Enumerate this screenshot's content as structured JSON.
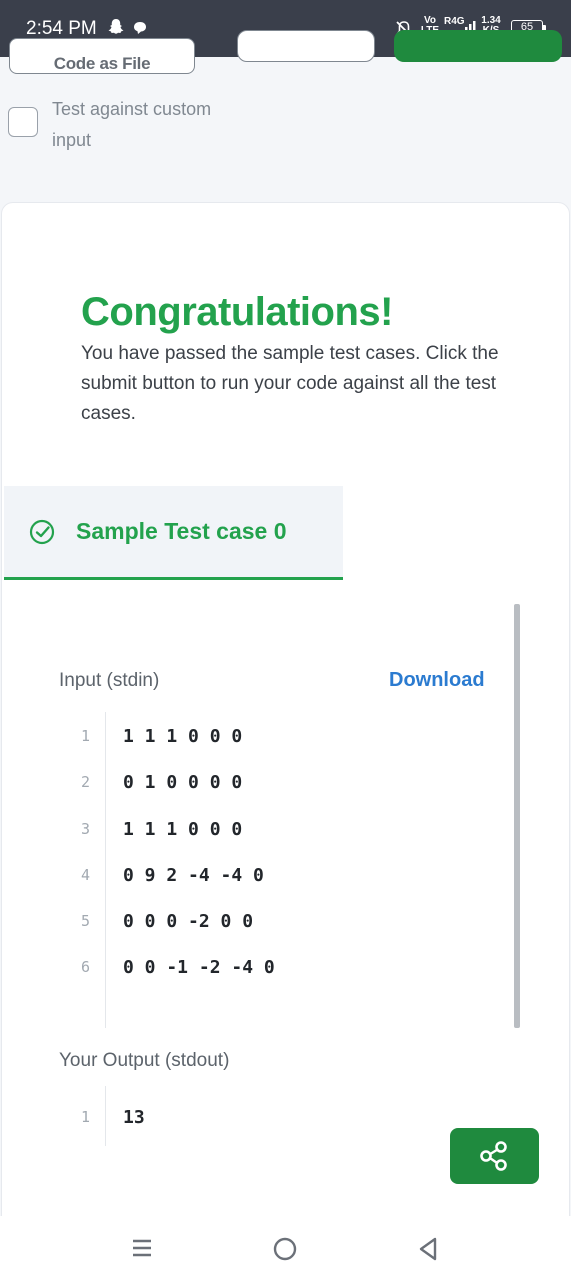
{
  "status_bar": {
    "time": "2:54 PM",
    "volte_top": "Vo",
    "volte_bottom": "LTE",
    "network": "R4G",
    "speed_value": "1.34",
    "speed_unit": "K/S",
    "battery": "65"
  },
  "toolbar": {
    "upload_code_label": "Code as File"
  },
  "custom_input": {
    "label": "Test against custom input",
    "checked": false
  },
  "result": {
    "title": "Congratulations!",
    "message": "You have passed the sample test cases. Click the submit button to run your code against all the test cases."
  },
  "tab": {
    "label": "Sample Test case 0"
  },
  "input_section": {
    "label": "Input (stdin)",
    "download_label": "Download",
    "lines": [
      {
        "num": "1",
        "code": "1 1 1 0 0 0"
      },
      {
        "num": "2",
        "code": "0 1 0 0 0 0"
      },
      {
        "num": "3",
        "code": "1 1 1 0 0 0"
      },
      {
        "num": "4",
        "code": "0 9 2 -4 -4 0"
      },
      {
        "num": "5",
        "code": "0 0 0 -2 0 0"
      },
      {
        "num": "6",
        "code": "0 0 -1 -2 -4 0"
      }
    ]
  },
  "output_section": {
    "label": "Your Output (stdout)",
    "lines": [
      {
        "num": "1",
        "code": "13"
      }
    ]
  },
  "colors": {
    "accent_green": "#23a24d",
    "button_green": "#1f8a3e",
    "link_blue": "#2b7bd0",
    "status_bar": "#3a3f4b"
  },
  "icons": {
    "share": "share-icon",
    "tab_status": "check-circle-icon",
    "nav_recent": "recent-apps-icon",
    "nav_home": "home-icon",
    "nav_back": "back-icon"
  }
}
